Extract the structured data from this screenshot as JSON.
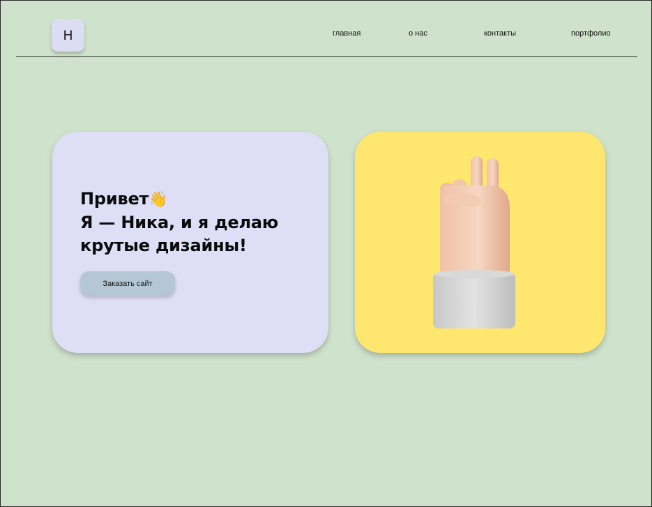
{
  "header": {
    "logo_letter": "Н",
    "nav": [
      {
        "label": "главная"
      },
      {
        "label": "о нас"
      },
      {
        "label": "контакты"
      },
      {
        "label": "портфолио"
      }
    ]
  },
  "hero": {
    "title_lines": [
      "Привет",
      "Я — Ника, и я делаю",
      "крутые дизайны!"
    ],
    "wave_emoji": "👋",
    "cta_label": "Заказать сайт"
  },
  "image_card": {
    "image": "victory-hand-3d-icon"
  },
  "colors": {
    "page_background": "#cfe2cb",
    "hero_card": "#dedff6",
    "image_card": "#ffe76f",
    "cta_button": "#b5c7d4",
    "logo_tile": "#dcdcf5"
  }
}
